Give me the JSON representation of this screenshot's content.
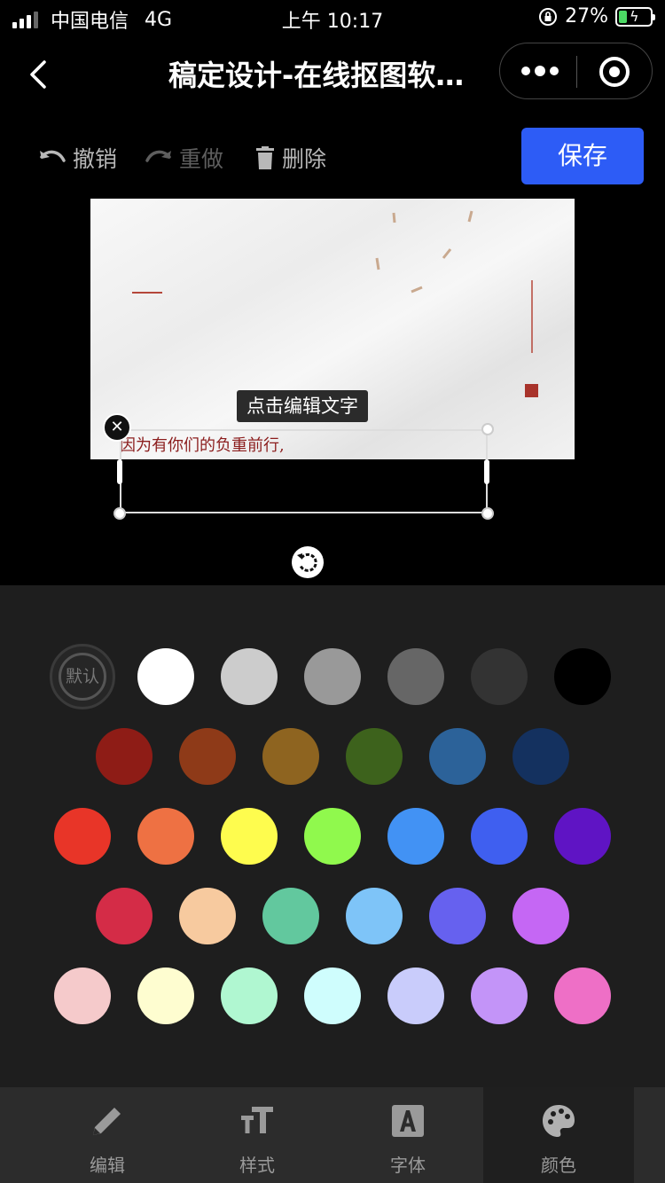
{
  "status_bar": {
    "carrier": "中国电信",
    "network": "4G",
    "time": "上午 10:17",
    "battery_percent": "27%",
    "battery_level": 0.27
  },
  "nav": {
    "title": "稿定设计-在线抠图软…",
    "more_icon": "more-dots-icon",
    "close_icon": "target-circle-icon"
  },
  "toolbar": {
    "undo_label": "撤销",
    "redo_label": "重做",
    "delete_label": "删除",
    "save_label": "保存",
    "accent_color": "#2d5cf6"
  },
  "canvas": {
    "text_content": "因为有你们的负重前行,",
    "tooltip": "点击编辑文字",
    "text_color": "#8b1d1d"
  },
  "color_panel": {
    "default_label": "默认",
    "rows": [
      [
        "#ffffff",
        "#cccccc",
        "#999999",
        "#666666",
        "#333333",
        "#000000"
      ],
      [
        "#8e1c16",
        "#8e3a18",
        "#8e6420",
        "#3d621c",
        "#2c6299",
        "#14315f"
      ],
      [
        "#e83528",
        "#ee7143",
        "#fefc4e",
        "#90f94d",
        "#4292f4",
        "#3f5ff0",
        "#5f14c4"
      ],
      [
        "#d42c47",
        "#f7ca9f",
        "#62c89e",
        "#7ec4f8",
        "#6661ef",
        "#c567f4"
      ],
      [
        "#f5cacb",
        "#fefdd0",
        "#b0f7d1",
        "#cffdfd",
        "#c9ccfb",
        "#c394f8",
        "#ee6fc6"
      ]
    ]
  },
  "tabs": [
    {
      "label": "编辑",
      "icon": "pencil-icon"
    },
    {
      "label": "样式",
      "icon": "text-size-icon"
    },
    {
      "label": "字体",
      "icon": "font-a-icon"
    },
    {
      "label": "颜色",
      "icon": "palette-icon",
      "active": true
    }
  ]
}
